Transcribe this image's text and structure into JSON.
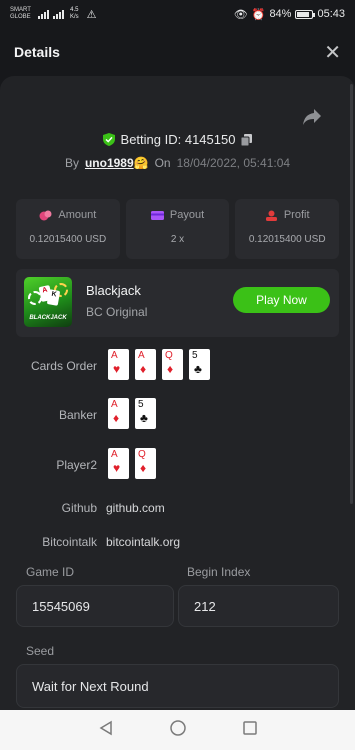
{
  "status_bar": {
    "carrier_line1": "SMART",
    "carrier_line2": "GLOBE",
    "speed_value": "4.5",
    "speed_unit": "K/s",
    "battery": "84%",
    "time": "05:43"
  },
  "header": {
    "title": "Details",
    "close_label": "✕"
  },
  "bet": {
    "id_label": "Betting ID: 4145150",
    "by_label": "By",
    "username": "uno1989",
    "emoji": "🤗",
    "on_label": "On",
    "date": "18/04/2022, 05:41:04"
  },
  "stats": [
    {
      "label": "Amount",
      "value": "0.12015400 USD",
      "icon": "amount-icon",
      "color": "#e0457b"
    },
    {
      "label": "Payout",
      "value": "2 x",
      "icon": "payout-icon",
      "color": "#a855f7"
    },
    {
      "label": "Profit",
      "value": "0.12015400 USD",
      "icon": "profit-icon",
      "color": "#e23b3b"
    }
  ],
  "game": {
    "name": "Blackjack",
    "provider": "BC Original",
    "thumb_text": "BLACKJACK",
    "play_label": "Play Now",
    "accent": "#3bc117"
  },
  "rows": {
    "cards_order": {
      "label": "Cards Order",
      "cards": [
        {
          "rank": "A",
          "suit": "♥"
        },
        {
          "rank": "A",
          "suit": "♦"
        },
        {
          "rank": "Q",
          "suit": "♦"
        },
        {
          "rank": "5",
          "suit": "♣"
        }
      ]
    },
    "banker": {
      "label": "Banker",
      "cards": [
        {
          "rank": "A",
          "suit": "♦"
        },
        {
          "rank": "5",
          "suit": "♣"
        }
      ]
    },
    "player2": {
      "label": "Player2",
      "cards": [
        {
          "rank": "A",
          "suit": "♥"
        },
        {
          "rank": "Q",
          "suit": "♦"
        }
      ]
    },
    "github": {
      "label": "Github",
      "value": "github.com"
    },
    "bitcointalk": {
      "label": "Bitcointalk",
      "value": "bitcointalk.org"
    }
  },
  "fields": {
    "game_id": {
      "label": "Game ID",
      "value": "15545069"
    },
    "begin_index": {
      "label": "Begin Index",
      "value": "212"
    },
    "seed": {
      "label": "Seed",
      "value": "Wait for Next Round"
    }
  },
  "nav": {
    "back_icon": "back-triangle-icon",
    "home_icon": "home-circle-icon",
    "recents_icon": "recents-square-icon"
  }
}
